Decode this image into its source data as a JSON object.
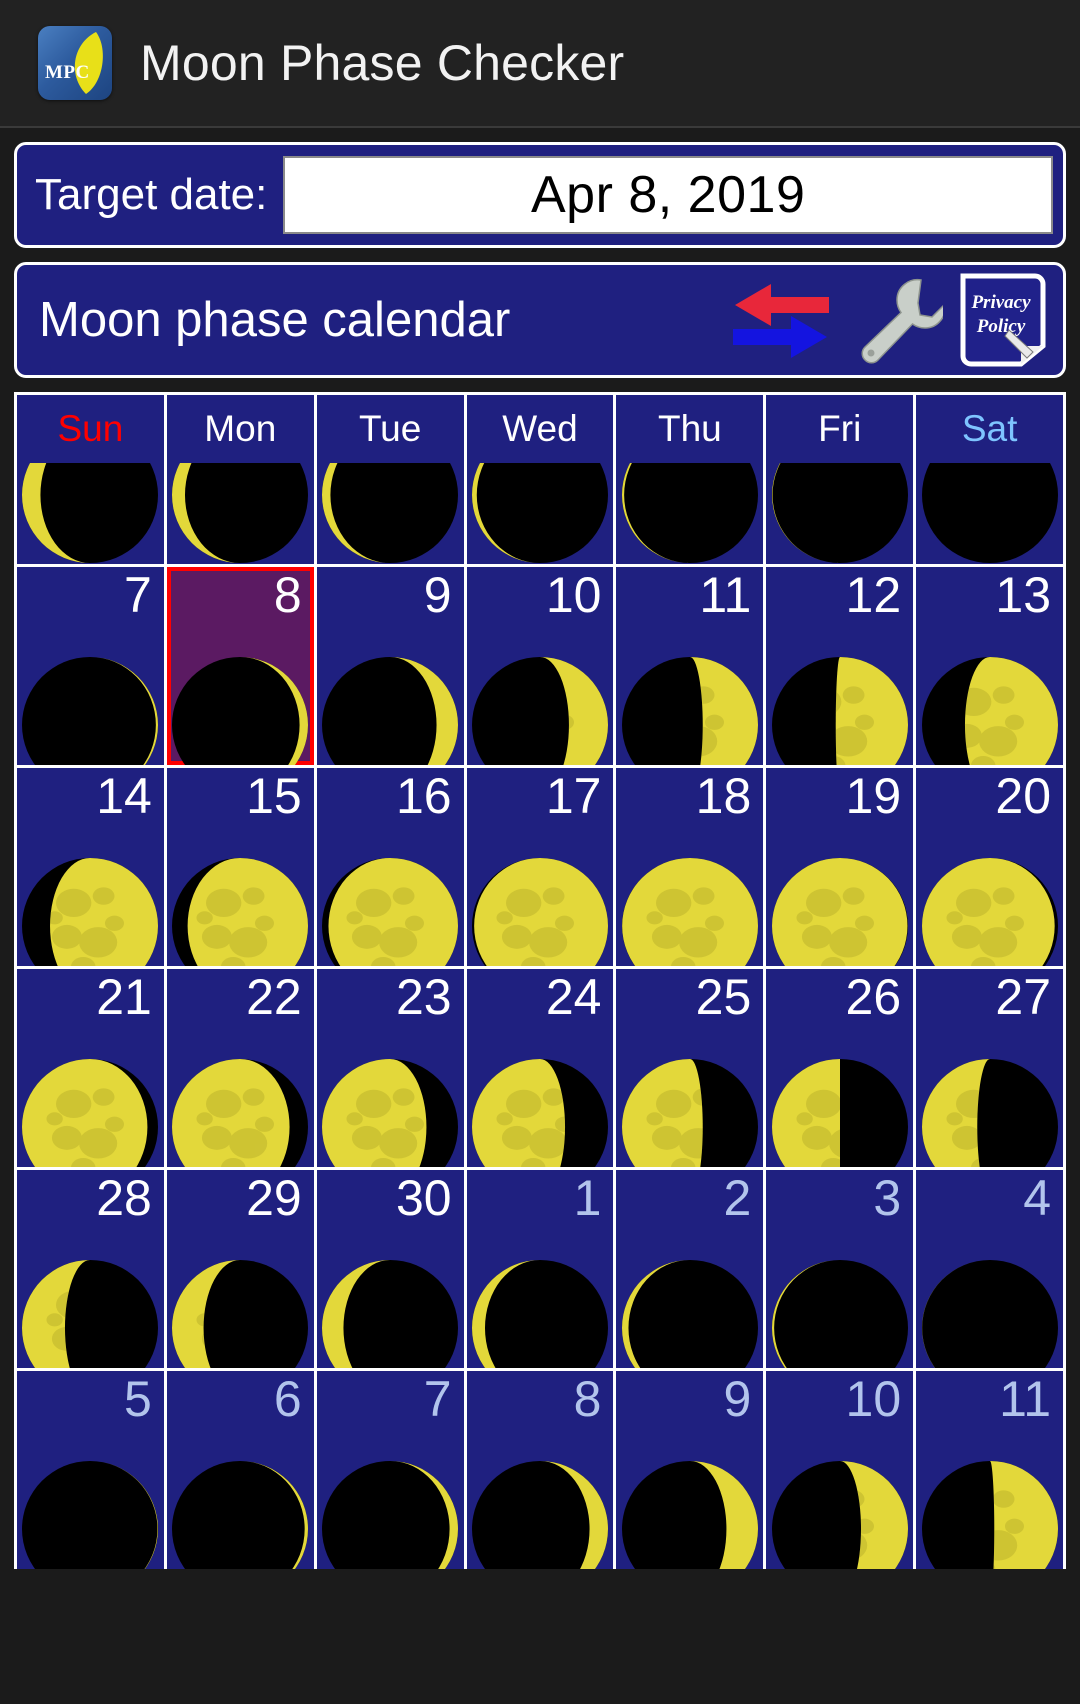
{
  "app": {
    "title": "Moon Phase Checker",
    "icon_name": "mpc-moon-logo",
    "icon_text": "MPC"
  },
  "target": {
    "label": "Target date:",
    "value": "Apr 8, 2019"
  },
  "calendar_bar": {
    "title": "Moon phase calendar",
    "icons": [
      {
        "name": "swap-arrows-icon",
        "colors": [
          "#e8273a",
          "#1414e0"
        ]
      },
      {
        "name": "wrench-icon",
        "color": "#c9cfc9"
      },
      {
        "name": "privacy-policy-icon",
        "line1": "Privacy",
        "line2": "Policy"
      }
    ]
  },
  "colors": {
    "panel_bg": "#1f2080",
    "border": "#ffffff",
    "sunday": "#ff0000",
    "saturday": "#7ec4ff",
    "weekday": "#ffffff",
    "selected_bg": "#5b1a62",
    "selected_border": "#ff0000",
    "other_month_text": "#b2c4ec",
    "moon_lit": "#e3d83a",
    "moon_dark": "#000000"
  },
  "weekdays": [
    {
      "label": "Sun",
      "color": "#ff0000"
    },
    {
      "label": "Mon",
      "color": "#ffffff"
    },
    {
      "label": "Tue",
      "color": "#ffffff"
    },
    {
      "label": "Wed",
      "color": "#ffffff"
    },
    {
      "label": "Thu",
      "color": "#ffffff"
    },
    {
      "label": "Fri",
      "color": "#ffffff"
    },
    {
      "label": "Sat",
      "color": "#7ec4ff"
    }
  ],
  "weeks": [
    {
      "partial": true,
      "days": [
        {
          "num": "",
          "phase": 0.88,
          "other_month": true,
          "selected": false
        },
        {
          "num": "",
          "phase": 0.9,
          "other_month": true,
          "selected": false
        },
        {
          "num": "",
          "phase": 0.92,
          "other_month": true,
          "selected": false
        },
        {
          "num": "",
          "phase": 0.94,
          "other_month": true,
          "selected": false
        },
        {
          "num": "",
          "phase": 0.96,
          "other_month": true,
          "selected": false
        },
        {
          "num": "",
          "phase": 0.98,
          "other_month": true,
          "selected": false
        },
        {
          "num": "",
          "phase": 1.0,
          "other_month": true,
          "selected": false
        }
      ]
    },
    {
      "partial": false,
      "days": [
        {
          "num": "7",
          "phase": 0.04,
          "other_month": false,
          "selected": false
        },
        {
          "num": "8",
          "phase": 0.08,
          "other_month": false,
          "selected": true
        },
        {
          "num": "9",
          "phase": 0.13,
          "other_month": false,
          "selected": false
        },
        {
          "num": "10",
          "phase": 0.18,
          "other_month": false,
          "selected": false
        },
        {
          "num": "11",
          "phase": 0.22,
          "other_month": false,
          "selected": false
        },
        {
          "num": "12",
          "phase": 0.26,
          "other_month": false,
          "selected": false
        },
        {
          "num": "13",
          "phase": 0.31,
          "other_month": false,
          "selected": false
        }
      ]
    },
    {
      "partial": false,
      "days": [
        {
          "num": "14",
          "phase": 0.35,
          "other_month": false,
          "selected": false
        },
        {
          "num": "15",
          "phase": 0.39,
          "other_month": false,
          "selected": false
        },
        {
          "num": "16",
          "phase": 0.43,
          "other_month": false,
          "selected": false
        },
        {
          "num": "17",
          "phase": 0.46,
          "other_month": false,
          "selected": false
        },
        {
          "num": "18",
          "phase": 0.49,
          "other_month": false,
          "selected": false
        },
        {
          "num": "19",
          "phase": 0.52,
          "other_month": false,
          "selected": false
        },
        {
          "num": "20",
          "phase": 0.55,
          "other_month": false,
          "selected": false
        }
      ]
    },
    {
      "partial": false,
      "days": [
        {
          "num": "21",
          "phase": 0.59,
          "other_month": false,
          "selected": false
        },
        {
          "num": "22",
          "phase": 0.62,
          "other_month": false,
          "selected": false
        },
        {
          "num": "23",
          "phase": 0.66,
          "other_month": false,
          "selected": false
        },
        {
          "num": "24",
          "phase": 0.69,
          "other_month": false,
          "selected": false
        },
        {
          "num": "25",
          "phase": 0.72,
          "other_month": false,
          "selected": false
        },
        {
          "num": "26",
          "phase": 0.75,
          "other_month": false,
          "selected": false
        },
        {
          "num": "27",
          "phase": 0.78,
          "other_month": false,
          "selected": false
        }
      ]
    },
    {
      "partial": false,
      "days": [
        {
          "num": "28",
          "phase": 0.81,
          "other_month": false,
          "selected": false
        },
        {
          "num": "29",
          "phase": 0.84,
          "other_month": false,
          "selected": false
        },
        {
          "num": "30",
          "phase": 0.87,
          "other_month": false,
          "selected": false
        },
        {
          "num": "1",
          "phase": 0.9,
          "other_month": true,
          "selected": false
        },
        {
          "num": "2",
          "phase": 0.93,
          "other_month": true,
          "selected": false
        },
        {
          "num": "3",
          "phase": 0.96,
          "other_month": true,
          "selected": false
        },
        {
          "num": "4",
          "phase": 0.99,
          "other_month": true,
          "selected": false
        }
      ]
    },
    {
      "partial": false,
      "days": [
        {
          "num": "5",
          "phase": 0.02,
          "other_month": true,
          "selected": false
        },
        {
          "num": "6",
          "phase": 0.05,
          "other_month": true,
          "selected": false
        },
        {
          "num": "7",
          "phase": 0.08,
          "other_month": true,
          "selected": false
        },
        {
          "num": "8",
          "phase": 0.12,
          "other_month": true,
          "selected": false
        },
        {
          "num": "9",
          "phase": 0.16,
          "other_month": true,
          "selected": false
        },
        {
          "num": "10",
          "phase": 0.2,
          "other_month": true,
          "selected": false
        },
        {
          "num": "11",
          "phase": 0.24,
          "other_month": true,
          "selected": false
        }
      ]
    }
  ]
}
